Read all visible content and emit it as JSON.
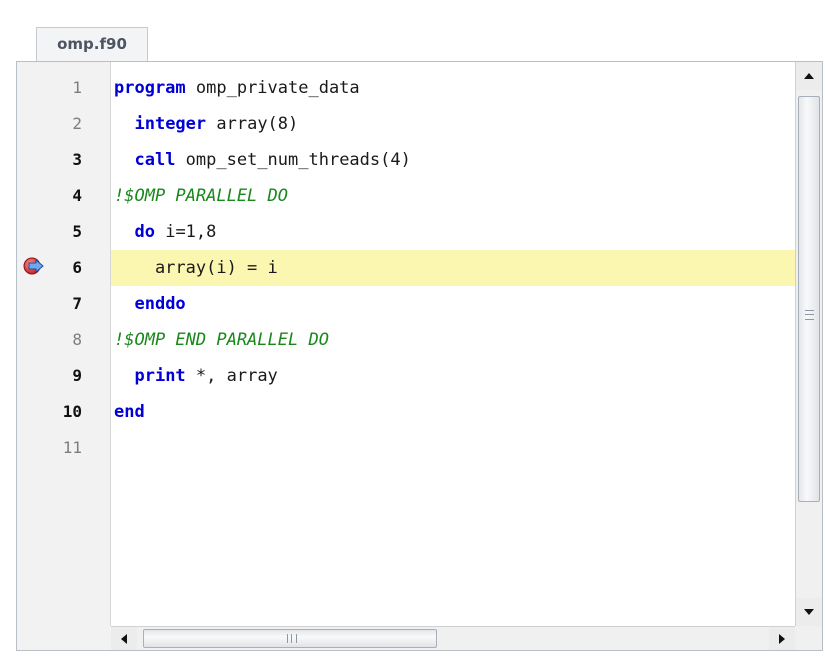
{
  "tab": {
    "label": "omp.f90"
  },
  "editor": {
    "current_line": 6,
    "lines": [
      {
        "num": "1",
        "bold": false,
        "tokens": [
          {
            "t": "program",
            "c": "kw"
          },
          {
            "t": " omp_private_data",
            "c": ""
          }
        ]
      },
      {
        "num": "2",
        "bold": false,
        "tokens": [
          {
            "t": "  ",
            "c": ""
          },
          {
            "t": "integer",
            "c": "kw"
          },
          {
            "t": " array(8)",
            "c": ""
          }
        ]
      },
      {
        "num": "3",
        "bold": true,
        "tokens": [
          {
            "t": "  ",
            "c": ""
          },
          {
            "t": "call",
            "c": "kw"
          },
          {
            "t": " omp_set_num_threads(4)",
            "c": ""
          }
        ]
      },
      {
        "num": "4",
        "bold": true,
        "tokens": [
          {
            "t": "!$OMP PARALLEL DO",
            "c": "cm"
          }
        ]
      },
      {
        "num": "5",
        "bold": true,
        "tokens": [
          {
            "t": "  ",
            "c": ""
          },
          {
            "t": "do",
            "c": "kw"
          },
          {
            "t": " i=1,8",
            "c": ""
          }
        ]
      },
      {
        "num": "6",
        "bold": true,
        "tokens": [
          {
            "t": "    array(i) = i",
            "c": ""
          }
        ]
      },
      {
        "num": "7",
        "bold": true,
        "tokens": [
          {
            "t": "  ",
            "c": ""
          },
          {
            "t": "enddo",
            "c": "kw"
          }
        ]
      },
      {
        "num": "8",
        "bold": false,
        "tokens": [
          {
            "t": "!$OMP END PARALLEL DO",
            "c": "cm"
          }
        ]
      },
      {
        "num": "9",
        "bold": true,
        "tokens": [
          {
            "t": "  ",
            "c": ""
          },
          {
            "t": "print",
            "c": "kw"
          },
          {
            "t": " *, array",
            "c": ""
          }
        ]
      },
      {
        "num": "10",
        "bold": true,
        "tokens": [
          {
            "t": "end",
            "c": "kw"
          }
        ]
      },
      {
        "num": "11",
        "bold": false,
        "tokens": []
      }
    ]
  },
  "breakpoint": {
    "line": 6,
    "icon": "current-position-arrow-icon"
  },
  "scrollbars": {
    "vertical": {
      "up_icon": "arrow-up-icon",
      "down_icon": "arrow-down-icon",
      "position": 0
    },
    "horizontal": {
      "left_icon": "arrow-left-icon",
      "right_icon": "arrow-right-icon",
      "position": 0
    }
  },
  "colors": {
    "keyword": "#0000d6",
    "comment": "#18881a",
    "current_line_bg": "#fbf6b0"
  }
}
